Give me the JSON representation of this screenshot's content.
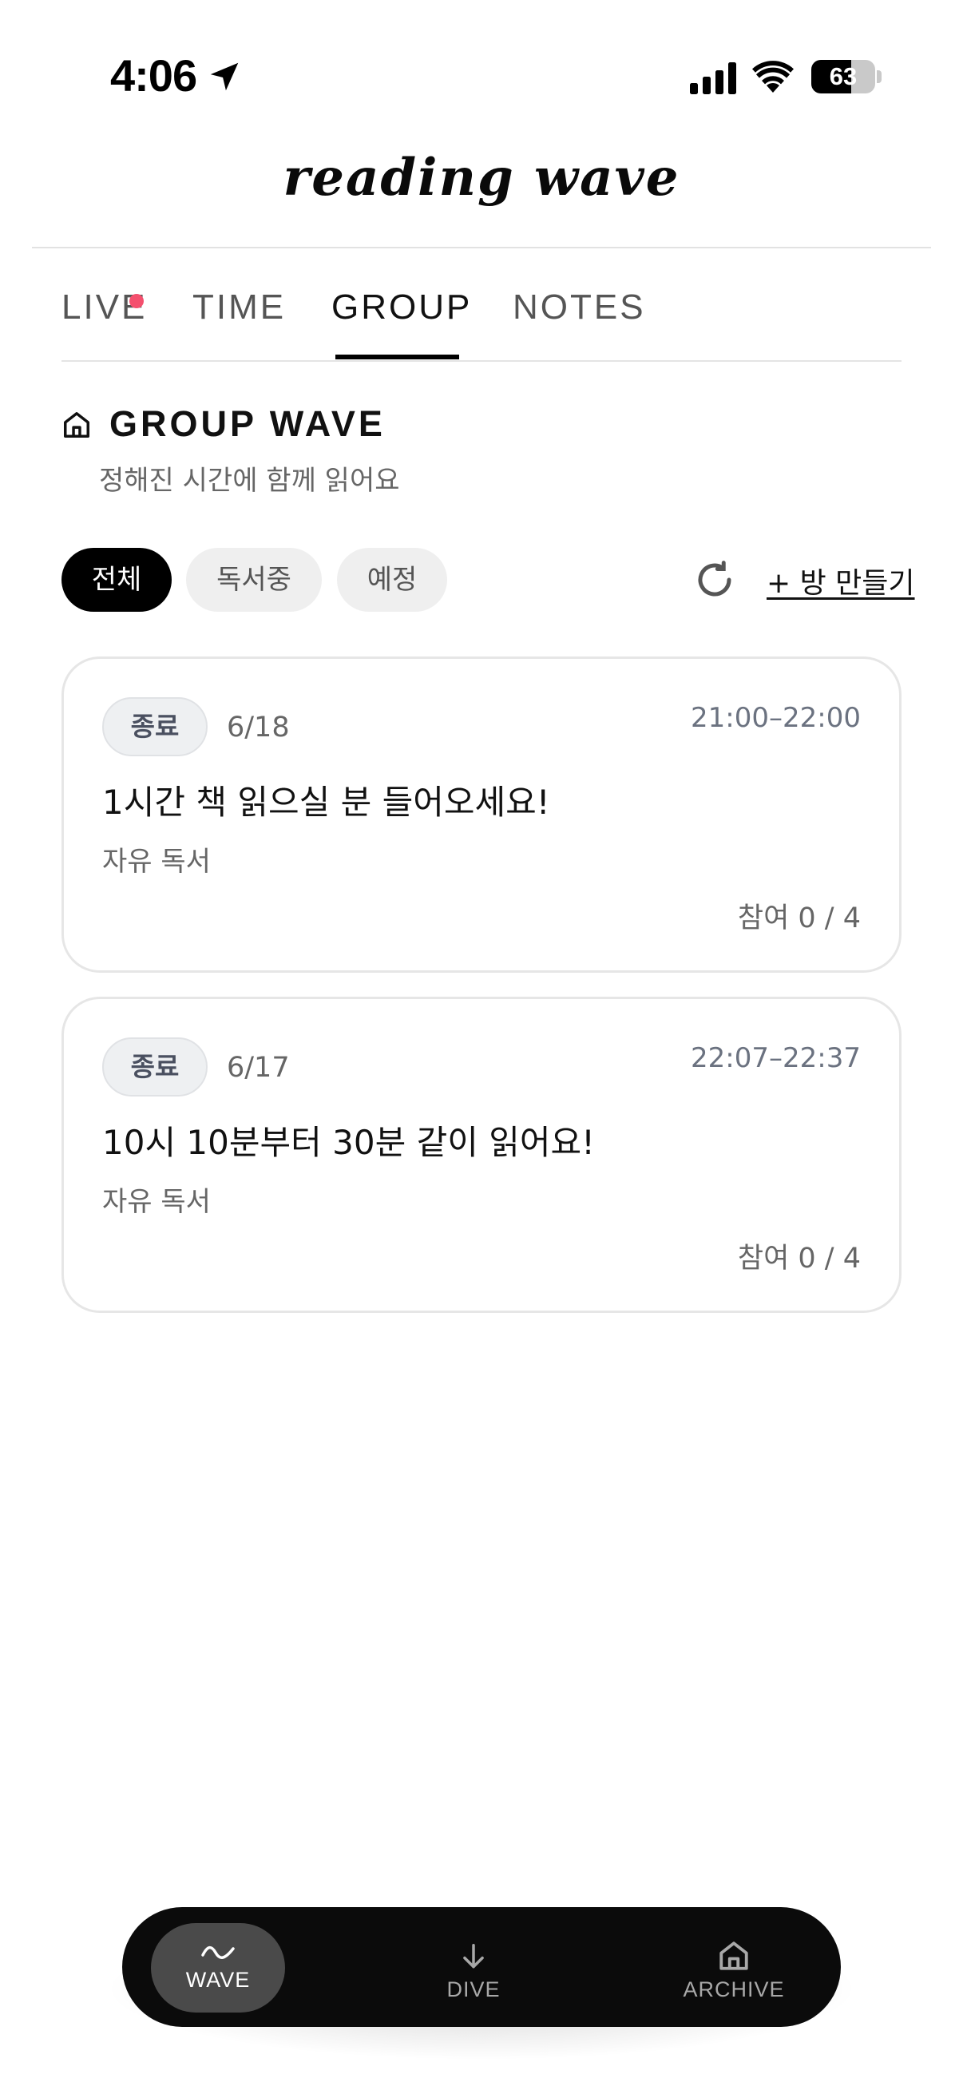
{
  "status_bar": {
    "time": "4:06",
    "battery": "63"
  },
  "app": {
    "logo": "reading wave"
  },
  "tabs": [
    {
      "label": "LIVE",
      "has_dot": true
    },
    {
      "label": "TIME"
    },
    {
      "label": "GROUP",
      "active": true
    },
    {
      "label": "NOTES"
    }
  ],
  "section": {
    "title": "GROUP WAVE",
    "subtitle": "정해진 시간에 함께 읽어요"
  },
  "filters": {
    "all": "전체",
    "reading": "독서중",
    "scheduled": "예정",
    "selected": "전체"
  },
  "actions": {
    "create_room": "+ 방 만들기"
  },
  "cards": [
    {
      "status": "종료",
      "date": "6/18",
      "time": "21:00–22:00",
      "title": "1시간 책 읽으실 분 들어오세요!",
      "type": "자유 독서",
      "participants": "참여 0 / 4"
    },
    {
      "status": "종료",
      "date": "6/17",
      "time": "22:07–22:37",
      "title": "10시 10분부터 30분 같이 읽어요!",
      "type": "자유 독서",
      "participants": "참여 0 / 4"
    }
  ],
  "bottom_nav": {
    "wave": "WAVE",
    "dive": "DIVE",
    "archive": "ARCHIVE",
    "active": "WAVE"
  },
  "colors": {
    "accent_dot": "#f4506e",
    "nav_bg": "#0b0b0b",
    "chip_active": "#000000"
  }
}
